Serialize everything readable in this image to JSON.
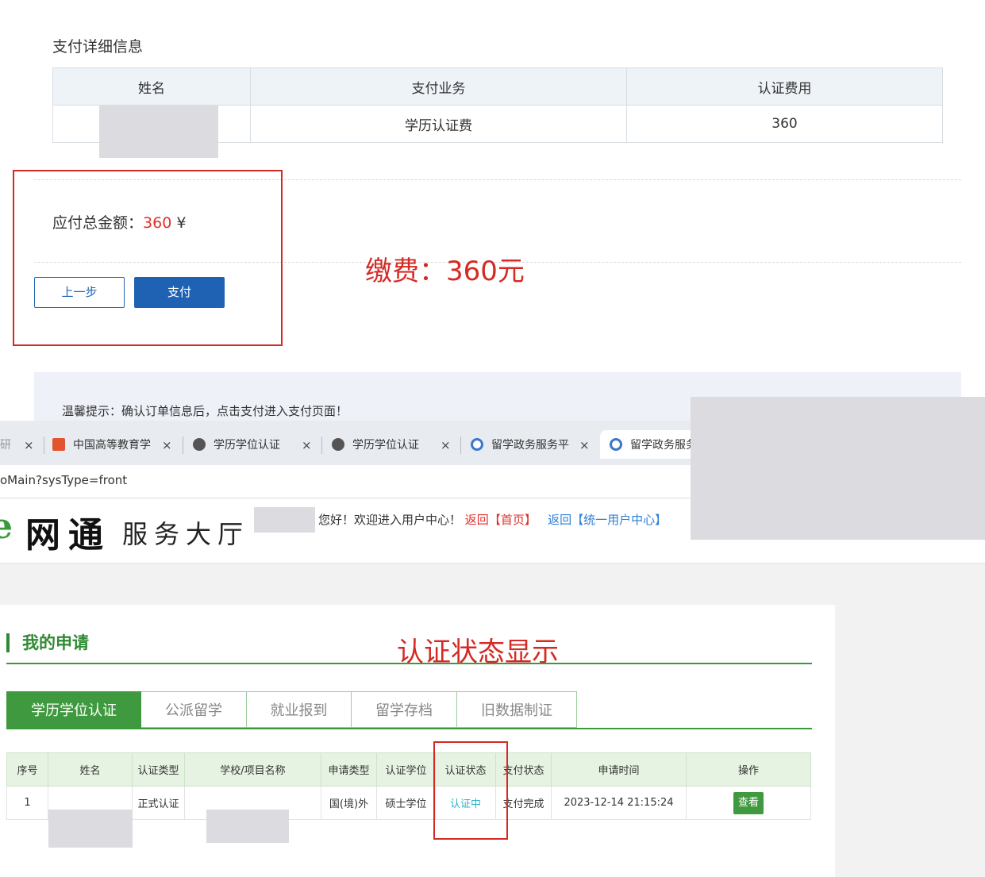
{
  "payment": {
    "section_title": "支付详细信息",
    "table_headers": [
      "姓名",
      "支付业务",
      "认证费用"
    ],
    "row": {
      "name": "",
      "business": "学历认证费",
      "fee": "360"
    },
    "total_label": "应付总金额：",
    "total_amount": "360",
    "currency": "¥",
    "prev_button": "上一步",
    "pay_button": "支付",
    "hint": "温馨提示：确认订单信息后，点击支付进入支付页面！"
  },
  "annotations": {
    "fee_note": "缴费：360元",
    "status_note": "认证状态显示"
  },
  "browser": {
    "tabs": [
      {
        "label": "研",
        "icon": "generic-tab-icon"
      },
      {
        "label": "中国高等教育学",
        "icon": "chsi-logo-icon"
      },
      {
        "label": "学历学位认证",
        "icon": "globe-icon"
      },
      {
        "label": "学历学位认证",
        "icon": "globe-icon"
      },
      {
        "label": "留学政务服务平",
        "icon": "cscse-logo-icon"
      },
      {
        "label": "留学政务服务",
        "icon": "cscse-logo-icon"
      }
    ],
    "close_glyph": "×",
    "url": "oMain?sysType=front"
  },
  "site": {
    "logo_e": "e",
    "logo_main": "网通",
    "logo_sub": "服务大厅",
    "welcome": "您好！欢迎进入用户中心！",
    "link_home_prefix": "返回",
    "link_home": "【首页】",
    "link_uc_prefix": "返回",
    "link_uc": "【统一用户中心】"
  },
  "my_apps": {
    "title": "我的申请",
    "tabs": [
      "学历学位认证",
      "公派留学",
      "就业报到",
      "留学存档",
      "旧数据制证"
    ],
    "headers": [
      "序号",
      "姓名",
      "认证类型",
      "学校/项目名称",
      "申请类型",
      "认证学位",
      "认证状态",
      "支付状态",
      "申请时间",
      "操作"
    ],
    "rows": [
      {
        "index": "1",
        "name": "",
        "cert_type": "正式认证",
        "school": "",
        "apply_type": "国(境)外",
        "degree": "硕士学位",
        "status": "认证中",
        "pay_status": "支付完成",
        "apply_time": "2023-12-14 21:15:24",
        "action": "查看"
      }
    ]
  },
  "colors": {
    "accent_blue": "#1f62b3",
    "annotation_red": "#d42a24",
    "amount_red": "#e0302b",
    "site_green": "#3f9a3f",
    "status_cyan": "#2db2c8"
  }
}
